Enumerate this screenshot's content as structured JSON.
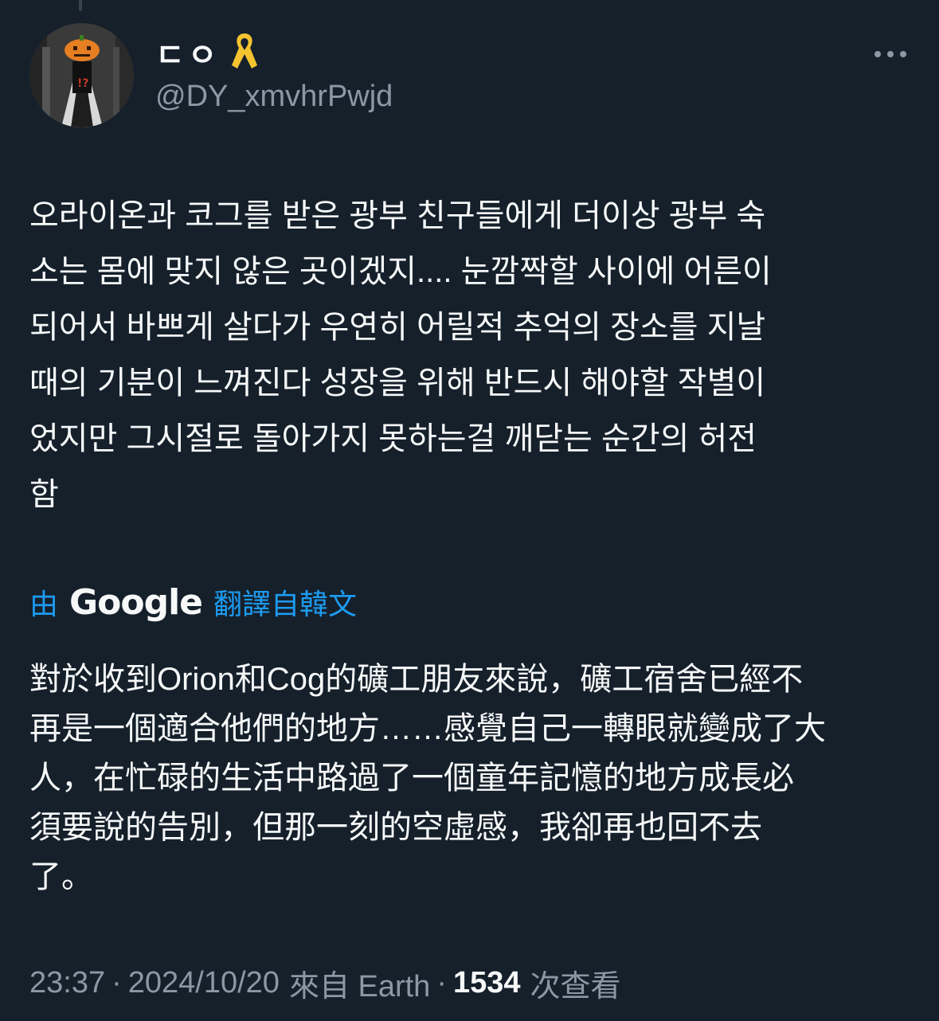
{
  "author": {
    "display_name": "ㄷㅇ",
    "handle": "@DY_xmvhrPwjd",
    "badge_icon": "yellow-ribbon-icon",
    "badge_color": "#f4c430",
    "avatar_icon": "pumpkin-head-avatar"
  },
  "menu": {
    "more_icon": "more-horizontal-icon"
  },
  "tweet": {
    "text": "오라이온과 코그를 받은 광부 친구들에게 더이상 광부 숙\n소는 몸에 맞지 않은 곳이겠지.... 눈깜짝할 사이에 어른이\n되어서 바쁘게 살다가 우연히 어릴적 추억의 장소를 지날\n때의 기분이 느껴진다 성장을 위해 반드시 해야할 작별이\n었지만 그시절로 돌아가지 못하는걸 깨닫는 순간의 허전\n함"
  },
  "translation": {
    "prefix": "由",
    "provider": "Google",
    "suffix": "翻譯自韓文",
    "text": "對於收到Orion和Cog的礦工朋友來說，礦工宿舍已經不\n再是一個適合他們的地方……感覺自己一轉眼就變成了大\n人，在忙碌的生活中路過了一個童年記憶的地方成長必\n須要說的告別，但那一刻的空虛感，我卻再也回不去\n了。"
  },
  "meta": {
    "time": "23:37",
    "separator": "·",
    "date": "2024/10/20",
    "source": "來自 Earth",
    "views_count": "1534",
    "views_label": "次查看"
  },
  "colors": {
    "background": "#15202b",
    "text_primary": "#f7f9f9",
    "text_secondary": "#8b98a5",
    "accent": "#1d9bf0"
  }
}
